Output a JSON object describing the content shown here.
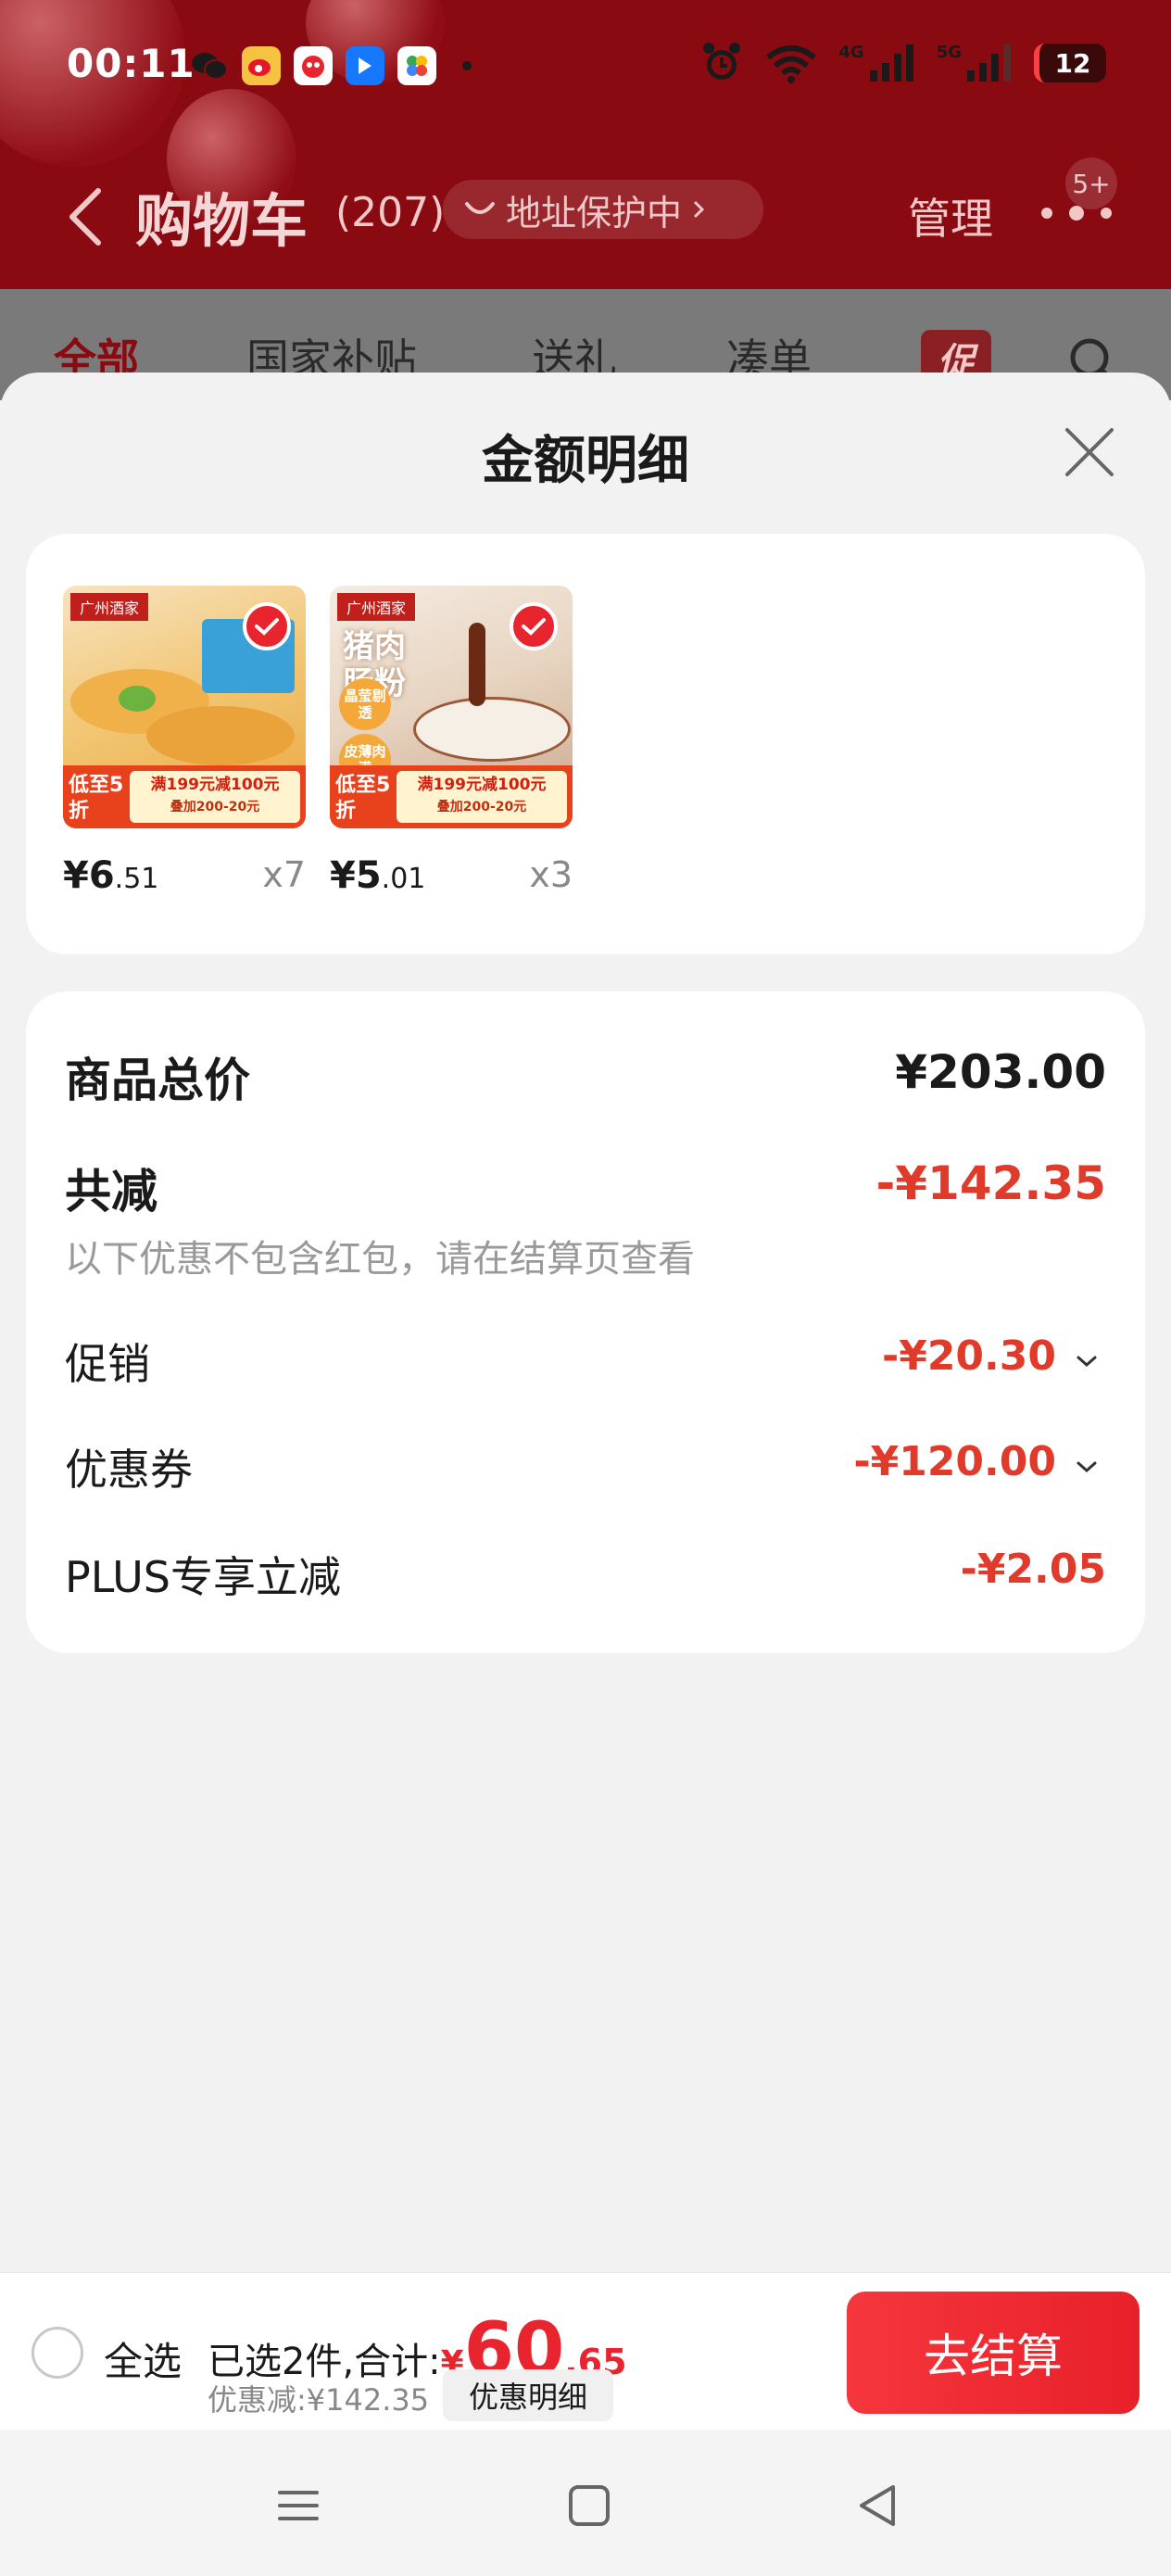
{
  "status_bar": {
    "time": "00:11",
    "signal_1": "4G",
    "signal_2": "5G",
    "battery": "12"
  },
  "nav": {
    "title": "购物车",
    "count": "(207)",
    "address_protect": "地址保护中",
    "manage": "管理",
    "badge": "5+"
  },
  "tabs": [
    {
      "label": "全部"
    },
    {
      "label": "国家补贴"
    },
    {
      "label": "送礼"
    },
    {
      "label": "凑单"
    }
  ],
  "promo_tab": "促",
  "sheet": {
    "title": "金额明细"
  },
  "products": [
    {
      "brand": "广州酒家",
      "banner_left": "低至5折",
      "banner_main": "满199元减100元",
      "banner_sub": "叠加200-20元",
      "price_int": "¥6",
      "price_dec": ".51",
      "qty": "x7"
    },
    {
      "brand": "广州酒家",
      "caption": "猪肉肠粉",
      "tag_1": "晶莹剔透",
      "tag_2": "皮薄肉满",
      "banner_left": "低至5折",
      "banner_main": "满199元减100元",
      "banner_sub": "叠加200-20元",
      "price_int": "¥5",
      "price_dec": ".01",
      "qty": "x3"
    }
  ],
  "summary": {
    "total_label": "商品总价",
    "total_value": "¥203.00",
    "reduce_label": "共减",
    "reduce_value": "-¥142.35",
    "note": "以下优惠不包含红包，请在结算页查看",
    "rows": [
      {
        "label": "促销",
        "value": "-¥20.30"
      },
      {
        "label": "优惠券",
        "value": "-¥120.00"
      },
      {
        "label": "PLUS专享立减",
        "value": "-¥2.05"
      }
    ]
  },
  "checkout": {
    "select_all": "全选",
    "selected_text": "已选2件,合计:",
    "total_currency": "¥",
    "total_int": "60",
    "total_dec": ".65",
    "discount_text": "优惠减:¥142.35",
    "discount_detail_btn": "优惠明细",
    "checkout_btn": "去结算"
  },
  "colors": {
    "brand_red": "#e8252e",
    "header_dark_red": "#8a0a12",
    "price_red": "#e03a2a"
  }
}
